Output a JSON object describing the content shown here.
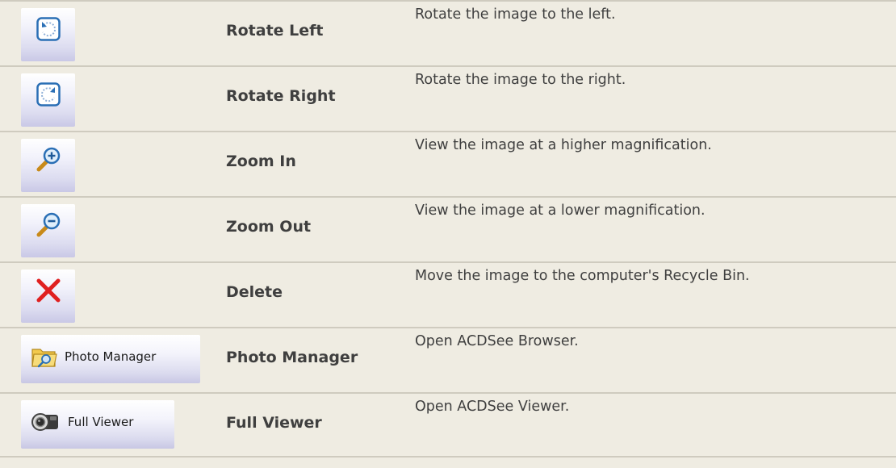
{
  "rows": [
    {
      "icon": "rotate-left-icon",
      "name": "Rotate Left",
      "description": "Rotate the image to the left."
    },
    {
      "icon": "rotate-right-icon",
      "name": "Rotate Right",
      "description": "Rotate the image to the right."
    },
    {
      "icon": "zoom-in-icon",
      "name": "Zoom In",
      "description": "View the image at a higher magnification."
    },
    {
      "icon": "zoom-out-icon",
      "name": "Zoom Out",
      "description": "View the image at a lower magnification."
    },
    {
      "icon": "delete-icon",
      "name": "Delete",
      "description": "Move the image to the computer's Recycle Bin."
    },
    {
      "icon": "photo-manager-icon",
      "name": "Photo Manager",
      "description": "Open ACDSee Browser.",
      "button_label": "Photo Manager"
    },
    {
      "icon": "full-viewer-icon",
      "name": "Full Viewer",
      "description": "Open ACDSee Viewer.",
      "button_label": "Full Viewer"
    }
  ],
  "colors": {
    "background": "#efece2",
    "divider": "#cfcbbf",
    "text": "#3f3f3f",
    "delete_red": "#e02020",
    "icon_blue": "#2a6fb5"
  }
}
